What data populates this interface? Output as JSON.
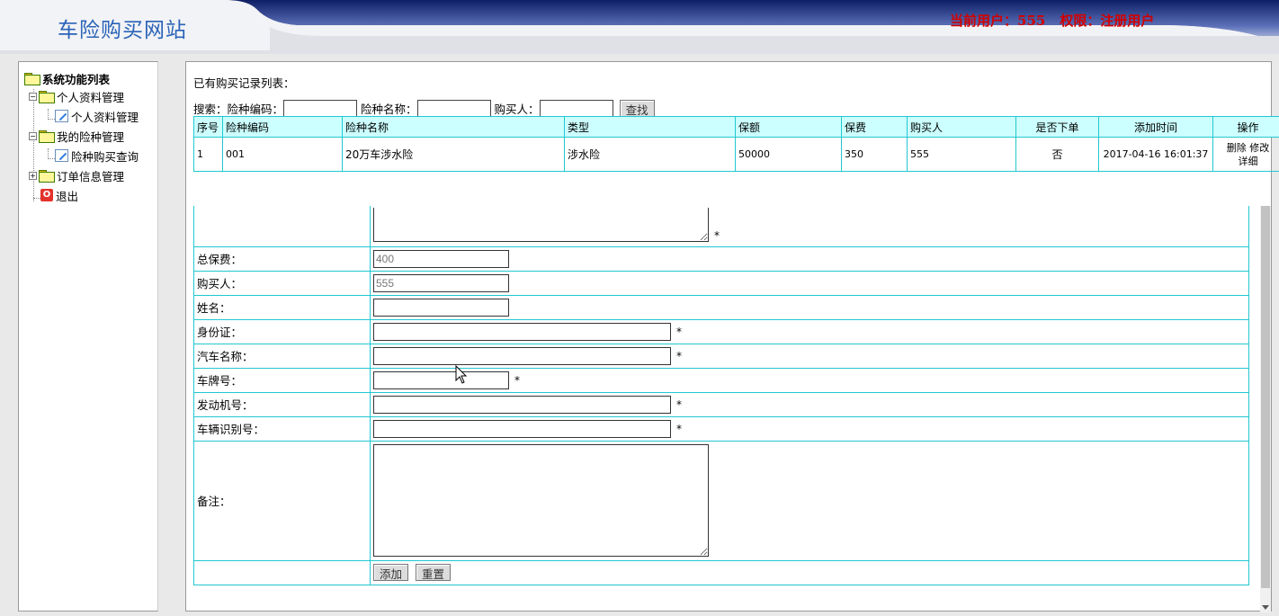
{
  "header": {
    "site_title": "车险购买网站",
    "current_user": "当前用户：555",
    "role": "权限：注册用户"
  },
  "sidebar": {
    "root_label": "系统功能列表",
    "groups": [
      {
        "label": "个人资料管理",
        "children": [
          "个人资料管理"
        ]
      },
      {
        "label": "我的险种管理",
        "children": [
          "险种购买查询"
        ]
      },
      {
        "label": "订单信息管理",
        "children": []
      }
    ],
    "exit_label": "退出"
  },
  "records": {
    "title": "已有购买记录列表：",
    "search": {
      "label_prefix": "搜索：",
      "code_label": "险种编码：",
      "name_label": "险种名称：",
      "buyer_label": "购买人：",
      "button": "查找"
    },
    "columns": [
      "序号",
      "险种编码",
      "险种名称",
      "类型",
      "保额",
      "保费",
      "购买人",
      "是否下单",
      "添加时间",
      "操作"
    ],
    "rows": [
      {
        "index": "1",
        "code": "001",
        "name": "20万车涉水险",
        "type": "涉水险",
        "amount": "50000",
        "premium": "350",
        "buyer": "555",
        "ordered": "否",
        "time": "2017-04-16 16:01:37",
        "ops": [
          "删除",
          "修改",
          "详细"
        ]
      }
    ]
  },
  "form": {
    "fields": [
      {
        "label": "总保费：",
        "value": "400"
      },
      {
        "label": "购买人：",
        "value": "555"
      },
      {
        "label": "姓名：",
        "value": ""
      },
      {
        "label": "身份证：",
        "value": ""
      },
      {
        "label": "汽车名称：",
        "value": ""
      },
      {
        "label": "车牌号：",
        "value": ""
      },
      {
        "label": "发动机号：",
        "value": ""
      },
      {
        "label": "车辆识别号：",
        "value": ""
      },
      {
        "label": "备注：",
        "value": ""
      }
    ],
    "required_mark": "*",
    "add_button": "添加",
    "reset_button": "重置"
  },
  "colors": {
    "title_blue": "#2a63b8",
    "user_red": "#d20000",
    "table_border": "#22c7d1",
    "table_header_bg": "#ccffff"
  }
}
